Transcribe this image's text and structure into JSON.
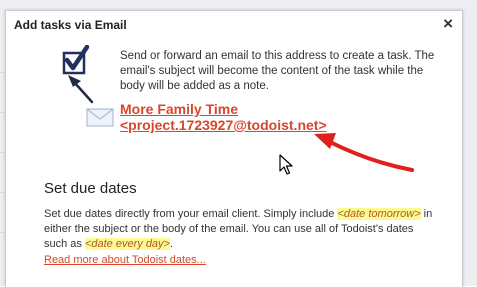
{
  "dialog": {
    "title": "Add tasks via Email",
    "close_label": "×"
  },
  "intro": {
    "text": "Send or forward an email to this address to create a task. The email's subject will become the content of the task while the body will be added as a note."
  },
  "email": {
    "line1": "More Family Time",
    "line2": "<project.1723927@todoist.net>"
  },
  "due_dates": {
    "title": "Set due dates",
    "text_1": "Set due dates directly from your email client. Simply include ",
    "example_1": "<date tomorrow>",
    "text_2": " in either the subject or the body of the email. You can use all of Todoist's dates such as ",
    "example_2": "<date every day>",
    "text_3": ".",
    "read_more": "Read more about Todoist dates..."
  },
  "colors": {
    "link": "#d9472b",
    "arrow": "#e0201a",
    "highlight": "#fbfb8f",
    "icon_navy": "#22305e"
  },
  "icons": [
    "checkbox-icon",
    "envelope-icon",
    "close-icon",
    "mouse-cursor-icon"
  ]
}
